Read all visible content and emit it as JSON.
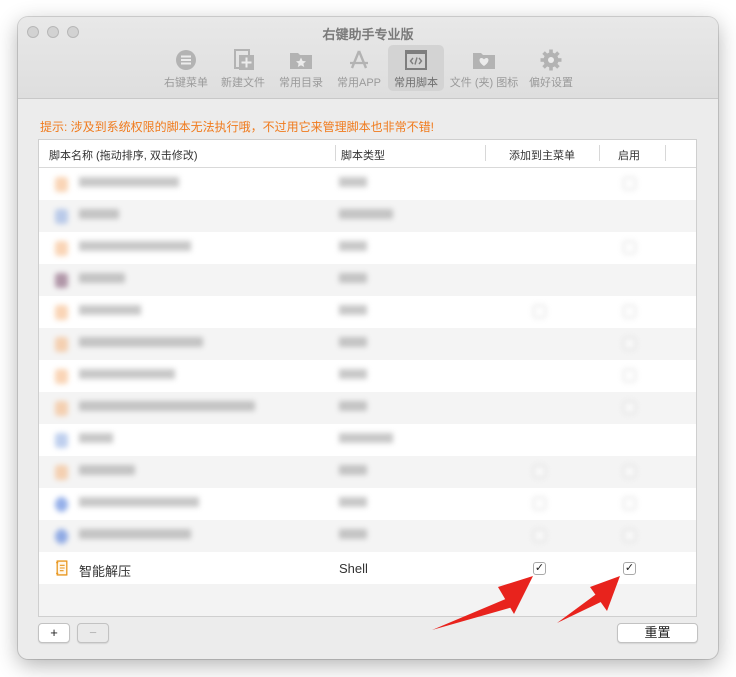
{
  "window": {
    "title": "右键助手专业版"
  },
  "toolbar": {
    "items": [
      {
        "label": "右键菜单",
        "icon": "list-icon"
      },
      {
        "label": "新建文件",
        "icon": "new-file-icon"
      },
      {
        "label": "常用目录",
        "icon": "star-folder-icon"
      },
      {
        "label": "常用APP",
        "icon": "app-store-icon"
      },
      {
        "label": "常用脚本",
        "icon": "script-icon",
        "selected": true
      },
      {
        "label": "文件 (夹) 图标",
        "icon": "heart-folder-icon"
      },
      {
        "label": "偏好设置",
        "icon": "gear-icon"
      }
    ]
  },
  "hint": "提示: 涉及到系统权限的脚本无法执行哦，不过用它来管理脚本也非常不错!",
  "table": {
    "columns": {
      "name": "脚本名称 (拖动排序, 双击修改)",
      "type": "脚本类型",
      "add_to_menu": "添加到主菜单",
      "enabled": "启用"
    },
    "visible_row": {
      "name": "智能解压",
      "type": "Shell",
      "add_to_menu": true,
      "enabled": true,
      "icon": "script-file-icon"
    }
  },
  "buttons": {
    "add": "+",
    "remove": "−",
    "reset": "重置"
  },
  "colors": {
    "hint": "#f07a1c",
    "arrow": "#e8231d"
  }
}
